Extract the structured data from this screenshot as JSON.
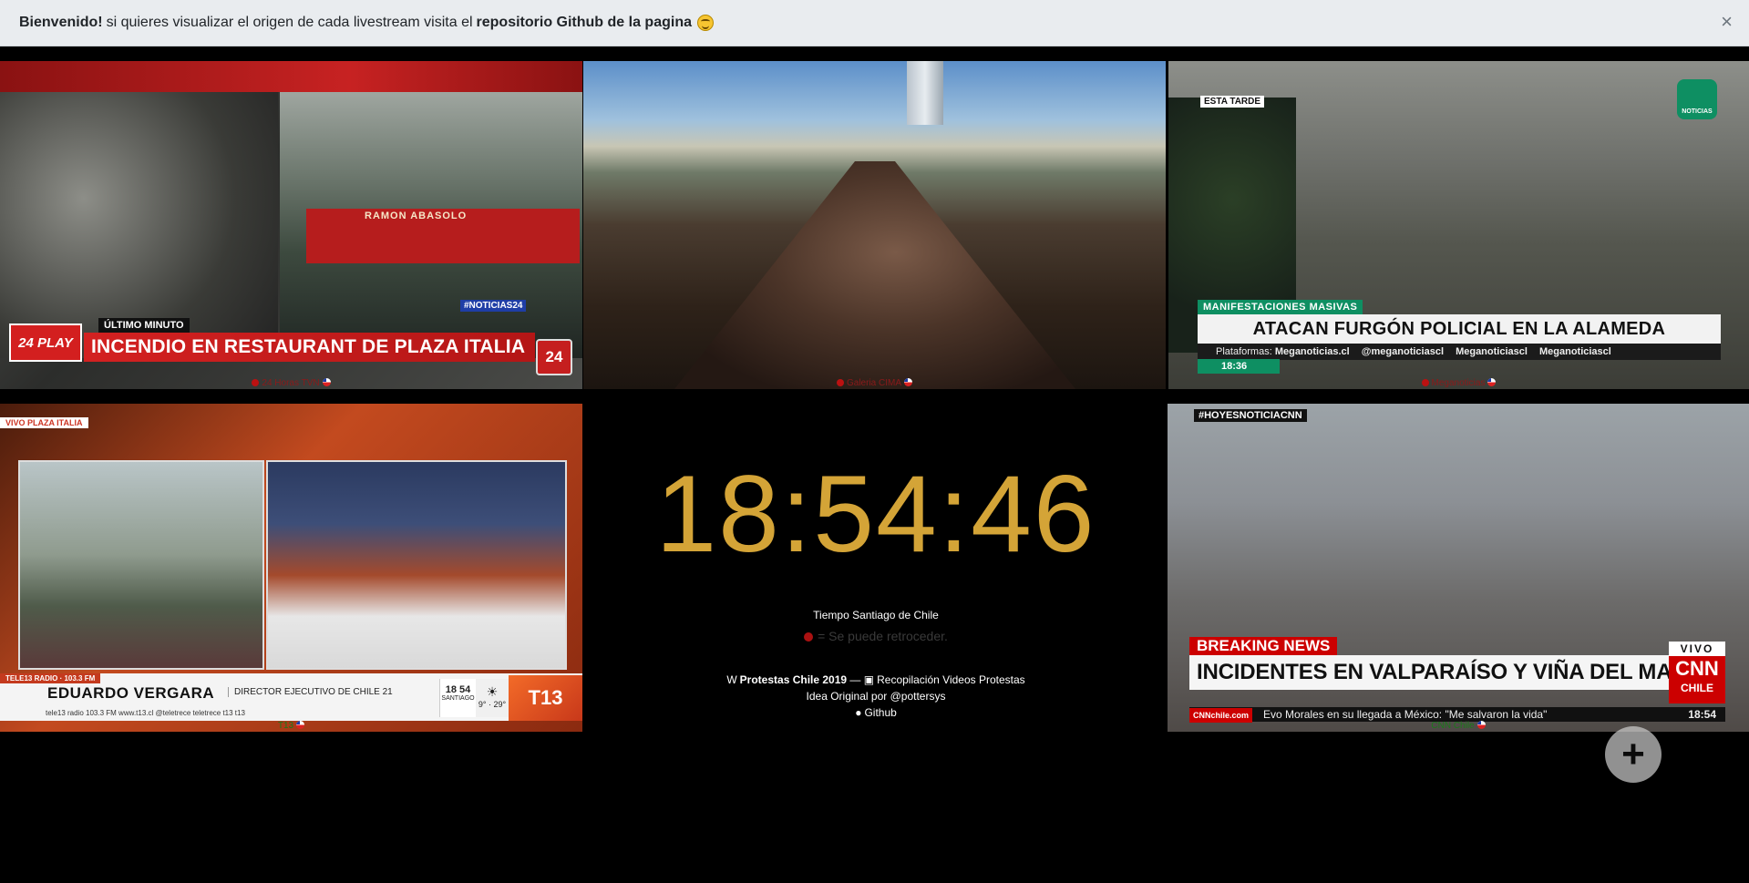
{
  "alert": {
    "bold1": "Bienvenido!",
    "text": "si quieres visualizar el origen de cada livestream visita el",
    "bold2": "repositorio Github de la pagina",
    "close": "×"
  },
  "streams": [
    {
      "label": "24 Horas TVN"
    },
    {
      "label": "Galeria CIMA"
    },
    {
      "label": "Meganoticias"
    },
    {
      "label": "T13"
    },
    {
      "label": "CNN Chile"
    }
  ],
  "tile1": {
    "kicker": "ÚLTIMO MINUTO",
    "headline": "INCENDIO EN RESTAURANT DE PLAZA ITALIA",
    "play": "24 PLAY",
    "hashtag": "#NOTICIAS24",
    "badge": "24",
    "truck": "RAMON ABASOLO"
  },
  "tile3": {
    "estatarde": "ESTA TARDE",
    "logo": "NOTICIAS",
    "cat": "MANIFESTACIONES MASIVAS",
    "head": "ATACAN FURGÓN POLICIAL EN LA ALAMEDA",
    "plat": "Plataformas:",
    "p1": "Meganoticias.cl",
    "p2": "@meganoticiascl",
    "p3": "Meganoticiascl",
    "p4": "Meganoticiascl",
    "time": "18:36"
  },
  "tile4": {
    "vivo": "VIVO PLAZA ITALIA",
    "radio": "TELE13 RADIO · 103.3 FM",
    "name": "EDUARDO VERGARA",
    "role": "DIRECTOR EJECUTIVO DE CHILE 21",
    "foot": "tele13 radio 103.3 FM   www.t13.cl   @teletrece   teletrece   t13   t13",
    "clock": "18 54",
    "city": "SANTIAGO",
    "temp": "9° · 29°",
    "logo": "T13"
  },
  "tile5": {
    "hashtag": "#HOYESNOTICIACNN",
    "bn": "BREAKING NEWS",
    "head": "INCIDENTES EN VALPARAÍSO Y VIÑA DEL MAR",
    "vivo": "VIVO",
    "cnn": "CNN",
    "chile": "CHILE",
    "src": "CNNchile.com",
    "ticker": "Evo Morales en su llegada a México: \"Me salvaron la vida\"",
    "time": "18:54"
  },
  "clock": {
    "time": "18:54:46",
    "tz": "Tiempo Santiago de Chile",
    "rewind": "= Se puede retroceder.",
    "title": "Protestas Chile 2019",
    "dash": "—",
    "compilation": "Recopilación Videos Protestas",
    "credit": "Idea Original por @pottersys",
    "github": "Github"
  },
  "plus": "+"
}
